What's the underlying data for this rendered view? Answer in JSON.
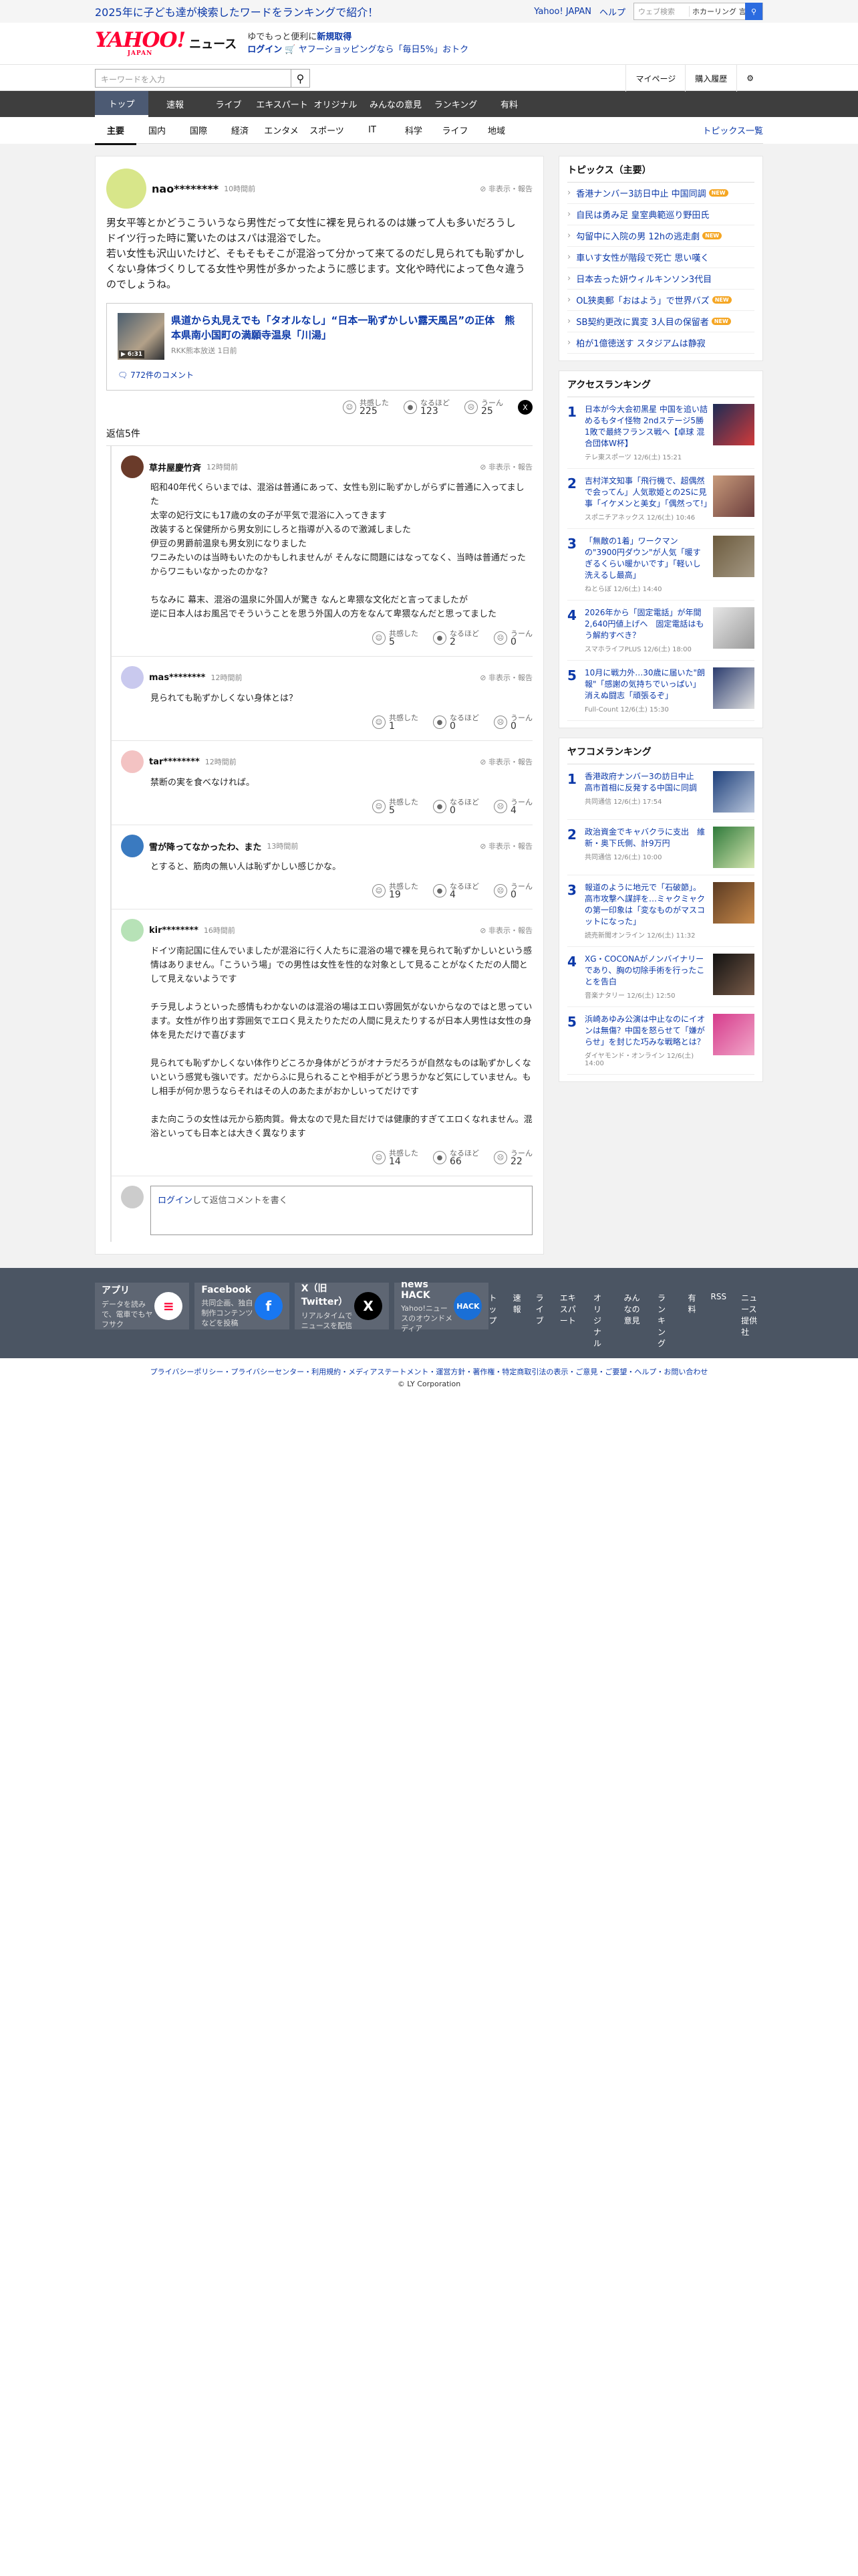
{
  "strip": {
    "promo": "2025年に子ども達が検索したワードをランキングで紹介！",
    "yjapan": "Yahoo! JAPAN",
    "help": "ヘルプ",
    "search_placeholder": "ウェブ検索",
    "trend": "ホカーリング 言…"
  },
  "header": {
    "logo": "YAHOO!",
    "logo_sub": "JAPAN",
    "logo_news": "ニュース",
    "line1_a": "ゆでもっと便利に",
    "line1_b": "新規取得",
    "login": "ログイン",
    "line2": "ヤフーショッピングなら「毎日5%」おトク"
  },
  "bar2": {
    "search_placeholder": "キーワードを入力",
    "mypage": "マイページ",
    "history": "購入履歴"
  },
  "nav": [
    "トップ",
    "速報",
    "ライブ",
    "エキスパート",
    "オリジナル",
    "みんなの意見",
    "ランキング",
    "有料"
  ],
  "cats": [
    "主要",
    "国内",
    "国際",
    "経済",
    "エンタメ",
    "スポーツ",
    "IT",
    "科学",
    "ライフ",
    "地域"
  ],
  "cats_all": "トピックス一覧",
  "comment": {
    "user": "nao********",
    "time": "10時間前",
    "report": "非表示・報告",
    "text": "男女平等とかどうこういうなら男性だって女性に裸を見られるのは嫌って人も多いだろうし\nドイツ行った時に驚いたのはスパは混浴でした。\n若い女性も沢山いたけど、そもそもそこが混浴って分かって来てるのだし見られても恥ずかしくない身体づくりしてる女性や男性が多かったように感じます。文化や時代によって色々違うのでしょうね。",
    "article_title": "県道から丸見えでも「タオルなし」“日本一恥ずかしい露天風呂”の正体　熊本県南小国町の満願寺温泉「川湯」",
    "article_src": "RKK熊本放送 1日前",
    "thumb_time": "6:31",
    "article_comments": "772件のコメント",
    "r1_label": "共感した",
    "r1": "225",
    "r2_label": "なるほど",
    "r2": "123",
    "r3_label": "うーん",
    "r3": "25"
  },
  "reply_count": "返信5件",
  "replies": [
    {
      "user": "草井屋慶竹斉",
      "time": "12時間前",
      "text": "昭和40年代くらいまでは、混浴は普通にあって、女性も別に恥ずかしがらずに普通に入ってました\n太宰の妃行文にも17歳の女の子が平気で混浴に入ってきます\n改装すると保健所から男女別にしろと指導が入るので激減しました\n伊豆の男爵前温泉も男女別になりました\nワニみたいのは当時もいたのかもしれませんが そんなに問題にはなってなく、当時は普通だったからワニもいなかったのかな？\n\nちなみに 幕末、混浴の温泉に外国人が驚き なんと卑猥な文化だと言ってましたが\n逆に日本人はお風呂でそういうことを思う外国人の方をなんて卑猥なんだと思ってました",
      "a": "5",
      "b": "2",
      "c": "0",
      "color": "#6a3b2a"
    },
    {
      "user": "mas********",
      "time": "12時間前",
      "text": "見られても恥ずかしくない身体とは？",
      "a": "1",
      "b": "0",
      "c": "0",
      "color": "#c9c9ee"
    },
    {
      "user": "tar********",
      "time": "12時間前",
      "text": "禁断の実を食べなければ。",
      "a": "5",
      "b": "0",
      "c": "4",
      "color": "#f3c3c3"
    },
    {
      "user": "雪が降ってなかったわ、また",
      "time": "13時間前",
      "text": "とすると、筋肉の無い人は恥ずかしい感じかな。",
      "a": "19",
      "b": "4",
      "c": "0",
      "color": "#3a7ac0"
    },
    {
      "user": "kir********",
      "time": "16時間前",
      "text": "ドイツ南記国に住んでいましたが混浴に行く人たちに混浴の場で裸を見られて恥ずかしいという感情はありません。「こういう場」での男性は女性を性的な対象として見ることがなくただの人間として見えないようです\n\nチラ見しようといった感情もわかないのは混浴の場はエロい雰囲気がないからなのではと思っています。女性が作り出す雰囲気でエロく見えたりただの人間に見えたりするが日本人男性は女性の身体を見ただけで喜びます\n\n見られても恥ずかしくない体作りどころか身体がどうがオナラだろうが自然なものは恥ずかしくないという感覚も強いです。だからふに見られることや相手がどう思うかなど気にしていません。もし相手が何か思うならそれはその人のあたまがおかしいってだけです\n\nまた向こうの女性は元から筋肉質。骨太なので見た目だけでは健康的すぎてエロくなれません。混浴といっても日本とは大きく異なります",
      "a": "14",
      "b": "66",
      "c": "22",
      "color": "#b7e2b7"
    }
  ],
  "reply_labels": {
    "a": "共感した",
    "b": "なるほど",
    "c": "うーん"
  },
  "replybox": {
    "login": "ログイン",
    "rest": "して返信コメントを書く"
  },
  "topics": {
    "title": "トピックス（主要）",
    "items": [
      {
        "t": "香港ナンバー3訪日中止 中国同調",
        "new": "NEW"
      },
      {
        "t": "自民は勇み足 皇室典範巡り野田氏",
        "new": ""
      },
      {
        "t": "勾留中に入院の男 12hの逃走劇",
        "new": "NEW"
      },
      {
        "t": "車いす女性が階段で死亡 思い嘆く",
        "new": ""
      },
      {
        "t": "日本去った妍ウィルキンソン3代目",
        "new": ""
      },
      {
        "t": "OL狭奥郵「おはよう」で世界バズ",
        "new": "NEW"
      },
      {
        "t": "SB契約更改に異変 3人目の保留者",
        "new": "NEW"
      },
      {
        "t": "柏が1億徳送す スタジアムは静寂",
        "new": ""
      }
    ]
  },
  "access": {
    "title": "アクセスランキング",
    "items": [
      {
        "n": "1",
        "t": "日本が今大会初黒星 中国を追い詰めるもタイ怪物 2ndステージ5勝1敗で最終フランス戦へ【卓球 混合団体W杯】",
        "s": "テレ東スポーツ 12/6(土) 15:21",
        "c1": "#1c2c55",
        "c2": "#d13a3a"
      },
      {
        "n": "2",
        "t": "吉村洋文知事「飛行機で、超偶然で会ってん」人気歌姫との2Sに見事「イケメンと美女」「偶然って!」",
        "s": "スポニチアネックス 12/6(土) 10:46",
        "c1": "#c79a7a",
        "c2": "#6b3d3d"
      },
      {
        "n": "3",
        "t": "「無敵の1着」ワークマンの\"3900円ダウン\"が人気「暖すぎるくらい暖かいです」「軽いし洗えるし最高」",
        "s": "ねとらぼ 12/6(土) 14:40",
        "c1": "#6b5a3d",
        "c2": "#a59984"
      },
      {
        "n": "4",
        "t": "2026年から「固定電話」が年間2,640円値上げへ　固定電話はもう解約すべき？",
        "s": "スマホライフPLUS 12/6(土) 18:00",
        "c1": "#e6e6e6",
        "c2": "#9a9a9a"
      },
      {
        "n": "5",
        "t": "10月に戦力外…30歳に届いた\"朗報\"「感謝の気持ちでいっぱい」消えぬ闘志「頑張るぞ」",
        "s": "Full-Count 12/6(土) 15:30",
        "c1": "#2b3c6e",
        "c2": "#e0e0e0"
      }
    ]
  },
  "yafoo": {
    "title": "ヤフコメランキング",
    "items": [
      {
        "n": "1",
        "t": "香港政府ナンバー3の訪日中止　高市首相に反発する中国に同調",
        "s": "共同通信 12/6(土) 17:54",
        "c1": "#1d3f7a",
        "c2": "#b9c6dc"
      },
      {
        "n": "2",
        "t": "政治資金でキャバクラに支出　維新・奥下氏側、計9万円",
        "s": "共同通信 12/6(土) 10:00",
        "c1": "#2f7a3b",
        "c2": "#d6e6b0"
      },
      {
        "n": "3",
        "t": "報道のように地元で「石破節」。高市攻撃へ謀評を…ミャクミャクの第一印象は「変なものがマスコットになった」",
        "s": "読売新聞オンライン 12/6(土) 11:32",
        "c1": "#5a3a22",
        "c2": "#c98a4a"
      },
      {
        "n": "4",
        "t": "XG・COCONAがノンバイナリーであり、胸の切除手術を行ったことを告白",
        "s": "音楽ナタリー 12/6(土) 12:50",
        "c1": "#111111",
        "c2": "#7a5c49"
      },
      {
        "n": "5",
        "t": "浜崎あゆみ公演は中止なのにイオンは無傷？中国を怒らせて「嫌がらせ」を封じた巧みな戦略とは？",
        "s": "ダイヤモンド・オンライン 12/6(土) 14:00",
        "c1": "#d63b8c",
        "c2": "#f1a7c9"
      }
    ]
  },
  "footer": {
    "cards": [
      {
        "t": "アプリ",
        "d": "データを読みで、電車でもヤフサク",
        "ic": "≡",
        "bg": "#ffffff",
        "fg": "#ff0033"
      },
      {
        "t": "Facebook",
        "d": "共同企画、独自制作コンテンツなどを投稿",
        "ic": "f",
        "bg": "#1877f2",
        "fg": "#ffffff"
      },
      {
        "t": "X（旧Twitter）",
        "d": "リアルタイムでニュースを配信",
        "ic": "X",
        "bg": "#000000",
        "fg": "#ffffff"
      },
      {
        "t": "news HACK",
        "d": "Yahoo!ニュースのオウンドメディア",
        "ic": "HACK",
        "bg": "#1a6fd6",
        "fg": "#ffffff"
      }
    ],
    "links": [
      "トップ",
      "速報",
      "ライブ",
      "エキスパート",
      "オリジナル",
      "みんなの意見",
      "ランキング",
      "有料",
      "RSS",
      "ニュース提供社"
    ],
    "legal": "プライバシーポリシー・プライバシーセンター・利用規約・メディアステートメント・運営方針・著作権・特定商取引法の表示・ご意見・ご要望・ヘルプ・お問い合わせ",
    "copy": "© LY Corporation"
  }
}
